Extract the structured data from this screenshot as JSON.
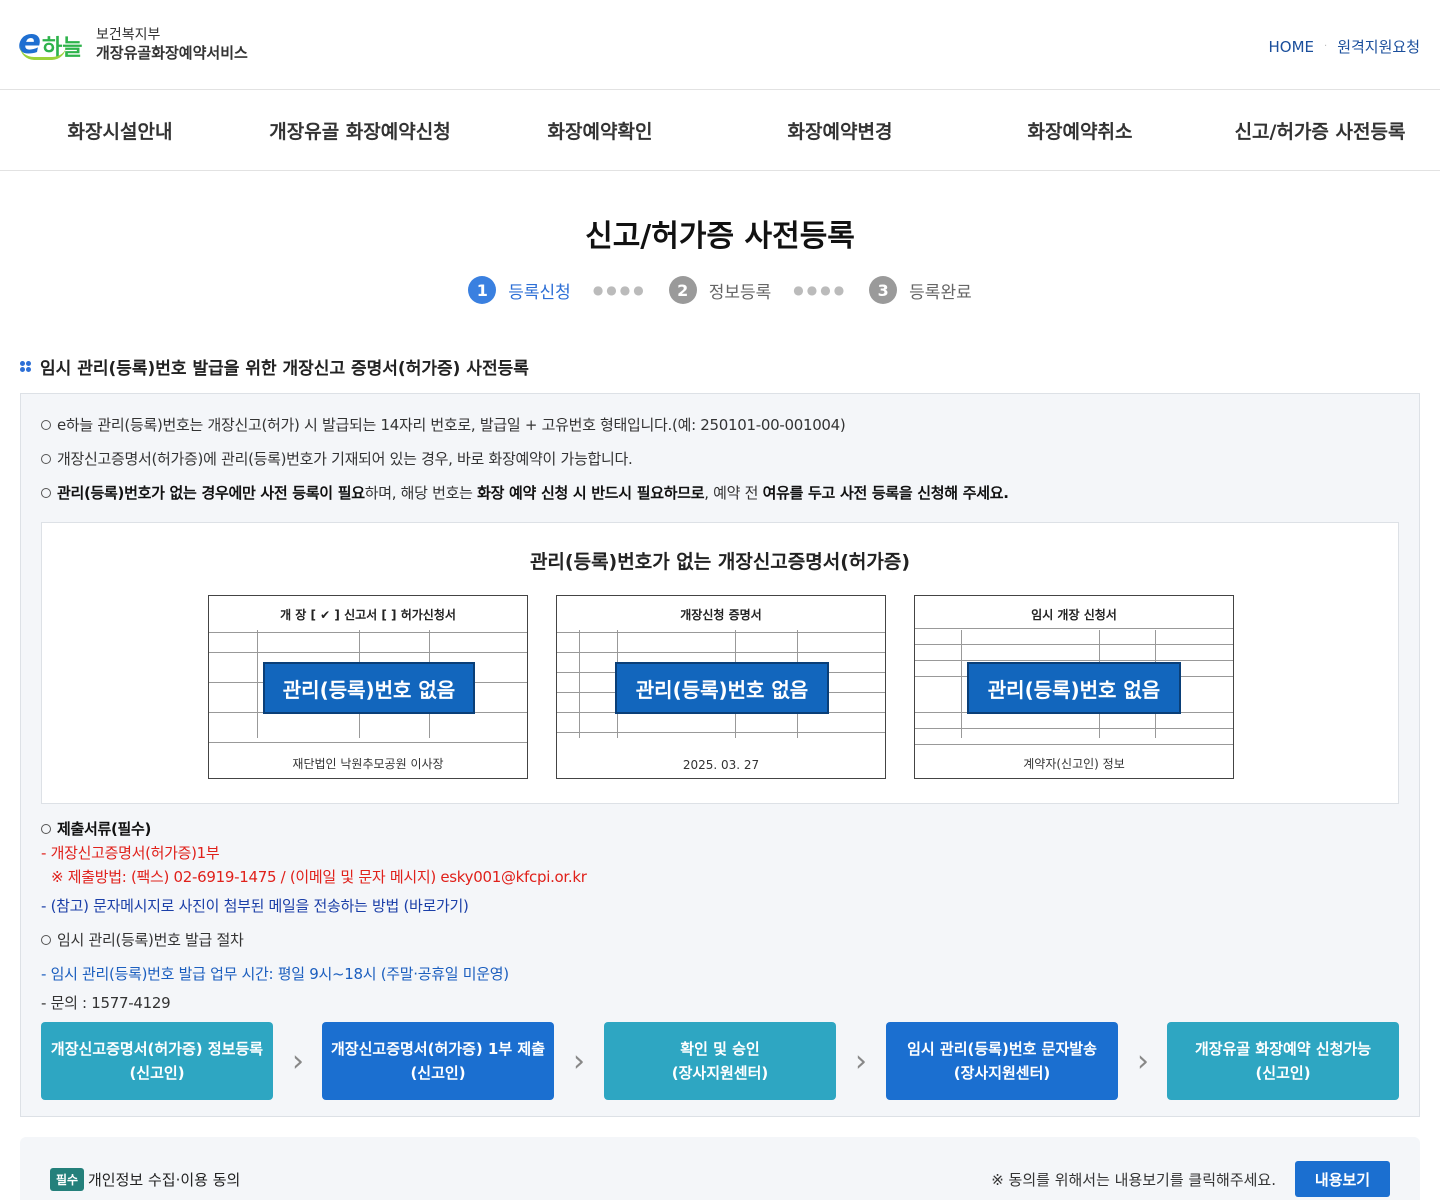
{
  "header": {
    "logo_mark_e": "e",
    "logo_mark_ha": "하늘",
    "ministry": "보건복지부",
    "service": "개장유골화장예약서비스",
    "links": [
      "HOME",
      "원격지원요청"
    ]
  },
  "nav": {
    "items": [
      "화장시설안내",
      "개장유골 화장예약신청",
      "화장예약확인",
      "화장예약변경",
      "화장예약취소",
      "신고/허가증 사전등록"
    ]
  },
  "page": {
    "title": "신고/허가증 사전등록"
  },
  "steps": [
    {
      "num": "1",
      "label": "등록신청",
      "active": true
    },
    {
      "num": "2",
      "label": "정보등록",
      "active": false
    },
    {
      "num": "3",
      "label": "등록완료",
      "active": false
    }
  ],
  "section": {
    "heading": "임시 관리(등록)번호 발급을 위한 개장신고 증명서(허가증) 사전등록"
  },
  "info": {
    "line1": "e하늘 관리(등록)번호는 개장신고(허가) 시 발급되는 14자리 번호로, 발급일 + 고유번호 형태입니다.(예: 250101-00-001004)",
    "line2": "개장신고증명서(허가증)에 관리(등록)번호가 기재되어 있는 경우, 바로 화장예약이 가능합니다.",
    "line3_b1": "관리(등록)번호가 없는 경우에만 사전 등록이 필요",
    "line3_t1": "하며, 해당 번호는 ",
    "line3_b2": "화장 예약 신청 시 반드시 필요하므로",
    "line3_t2": ", 예약 전 ",
    "line3_b3": "여유를 두고 사전 등록을 신청해 주세요."
  },
  "samples": {
    "title": "관리(등록)번호가 없는 개장신고증명서(허가증)",
    "docs": [
      {
        "head": "개 장 [ ✔ ] 신고서  [  ] 허가신청서",
        "foot": "재단법인 낙원추모공원 이사장",
        "badge": "관리(등록)번호 없음"
      },
      {
        "head": "개장신청 증명서",
        "foot": "2025. 03. 27",
        "badge": "관리(등록)번호 없음"
      },
      {
        "head": "임시 개장 신청서",
        "foot": "계약자(신고인) 정보",
        "badge": "관리(등록)번호 없음"
      }
    ]
  },
  "requirements": {
    "title": "제출서류(필수)",
    "doc": "- 개장신고증명서(허가증)1부",
    "method": "※ 제출방법: (팩스) 02-6919-1475 / (이메일 및 문자 메시지) esky001@kfcpi.or.kr",
    "ref_link": "- (참고) 문자메시지로 사진이 첨부된 메일을 전송하는 방법 (바로가기)",
    "proc_title": "임시 관리(등록)번호 발급 절차",
    "hours": "- 임시 관리(등록)번호 발급 업무 시간: 평일 9시~18시 (주말·공휴일 미운영)",
    "contact": "- 문의 : 1577-4129"
  },
  "flow": [
    {
      "l1": "개장신고증명서(허가증) 정보등록",
      "l2": "(신고인)",
      "style": "teal"
    },
    {
      "l1": "개장신고증명서(허가증) 1부 제출",
      "l2": "(신고인)",
      "style": "navy"
    },
    {
      "l1": "확인 및 승인",
      "l2": "(장사지원센터)",
      "style": "teal"
    },
    {
      "l1": "임시 관리(등록)번호 문자발송",
      "l2": "(장사지원센터)",
      "style": "navy"
    },
    {
      "l1": "개장유골 화장예약 신청가능",
      "l2": "(신고인)",
      "style": "teal"
    }
  ],
  "consent": {
    "badge": "필수",
    "title": "개인정보 수집·이용 동의",
    "note": "※ 동의를 위해서는 내용보기를 클릭해주세요.",
    "button": "내용보기"
  },
  "colors": {
    "primary": "#1b6fd0",
    "teal": "#2ea6c2",
    "red": "#e0211b",
    "badge_blue": "#1266bd"
  }
}
